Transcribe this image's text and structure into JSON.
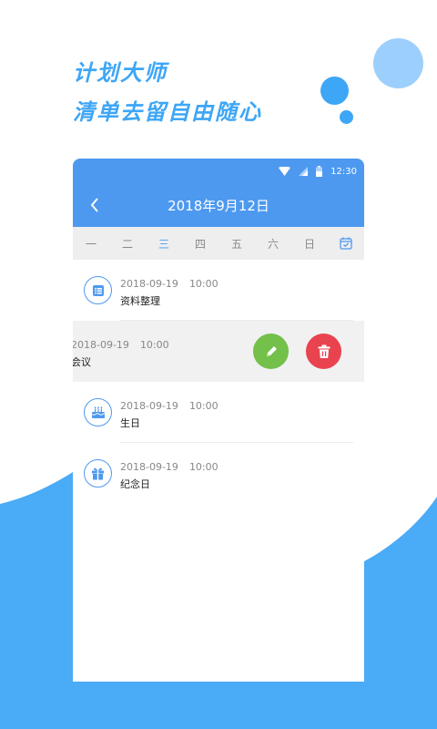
{
  "slogan": {
    "line1": "计划大师",
    "line2": "清单去留自由随心"
  },
  "colors": {
    "primary": "#4d99f0",
    "accent": "#3ea6f6",
    "edit": "#73c04a",
    "delete": "#e8434f"
  },
  "status_bar": {
    "time": "12:30",
    "icons": [
      "wifi-icon",
      "signal-icon",
      "battery-icon"
    ]
  },
  "header": {
    "title": "2018年9月12日",
    "back_icon": "chevron-left-icon"
  },
  "week": {
    "days": [
      "一",
      "二",
      "三",
      "四",
      "五",
      "六",
      "日"
    ],
    "active_day": "三",
    "calendar_icon": "calendar-check-icon"
  },
  "items": [
    {
      "date": "2018-09-19",
      "time": "10:00",
      "title": "资料整理",
      "icon": "list-icon"
    },
    {
      "date": "2018-09-19",
      "time": "10:00",
      "title": "会议",
      "icon": "none",
      "swiped": true,
      "actions": [
        "edit-icon",
        "trash-icon"
      ]
    },
    {
      "date": "2018-09-19",
      "time": "10:00",
      "title": "生日",
      "icon": "cake-icon"
    },
    {
      "date": "2018-09-19",
      "time": "10:00",
      "title": "纪念日",
      "icon": "gift-icon"
    }
  ]
}
